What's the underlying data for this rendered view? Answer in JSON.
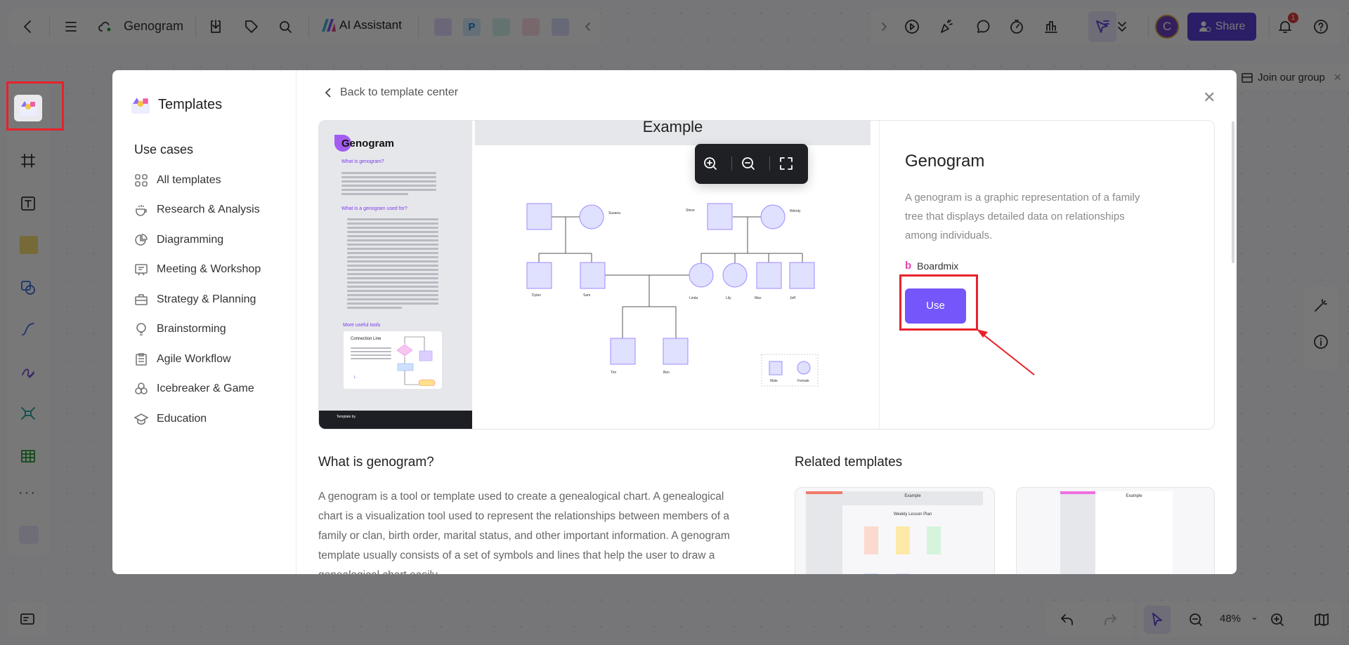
{
  "toolbar": {
    "doc_title": "Genogram",
    "ai_label": "AI Assistant",
    "share_label": "Share",
    "avatar_initial": "C",
    "notification_count": "1"
  },
  "join_group": "Join our group",
  "zoom_level": "48%",
  "modal": {
    "title": "Templates",
    "section": "Use cases",
    "categories": [
      "All templates",
      "Research & Analysis",
      "Diagramming",
      "Meeting & Workshop",
      "Strategy & Planning",
      "Brainstorming",
      "Agile Workflow",
      "Icebreaker & Game",
      "Education"
    ],
    "back_label": "Back to template center",
    "preview": {
      "doc_title": "Genogram",
      "h1": "What is genogram?",
      "h2": "What is a genogram used for?",
      "h3": "More useful tools",
      "tool_title": "Connection Line",
      "tool_key": "L",
      "template_by": "Template by",
      "example_title": "Example",
      "people": [
        "Susana",
        "Steve",
        "Wendy",
        "Dylan",
        "Sam",
        "Linda",
        "Lily",
        "Max",
        "Jeff",
        "Tim",
        "Ben"
      ],
      "legend": [
        "Male",
        "Female"
      ]
    },
    "info": {
      "title": "Genogram",
      "description": "A genogram is a graphic representation of a family tree that displays detailed data on relationships among individuals.",
      "author": "Boardmix",
      "use_label": "Use"
    },
    "about_heading": "What is genogram?",
    "about_text": "A genogram is a tool or template used to create a genealogical chart. A genealogical chart is a visualization tool used to represent the relationships between members of a family or clan, birth order, marital status, and other important information. A genogram template usually consists of a set of symbols and lines that help the user to draw a genealogical chart easily.",
    "related_heading": "Related templates",
    "related": [
      {
        "header": "Example",
        "title": "Weekly Lesson Plan"
      },
      {
        "header": "Example"
      }
    ]
  },
  "colors": {
    "accent": "#7556fb",
    "share": "#5b3fd9",
    "highlight": "#e8212b",
    "shape_fill": "#e0e0ff",
    "shape_stroke": "#9b8cff"
  }
}
